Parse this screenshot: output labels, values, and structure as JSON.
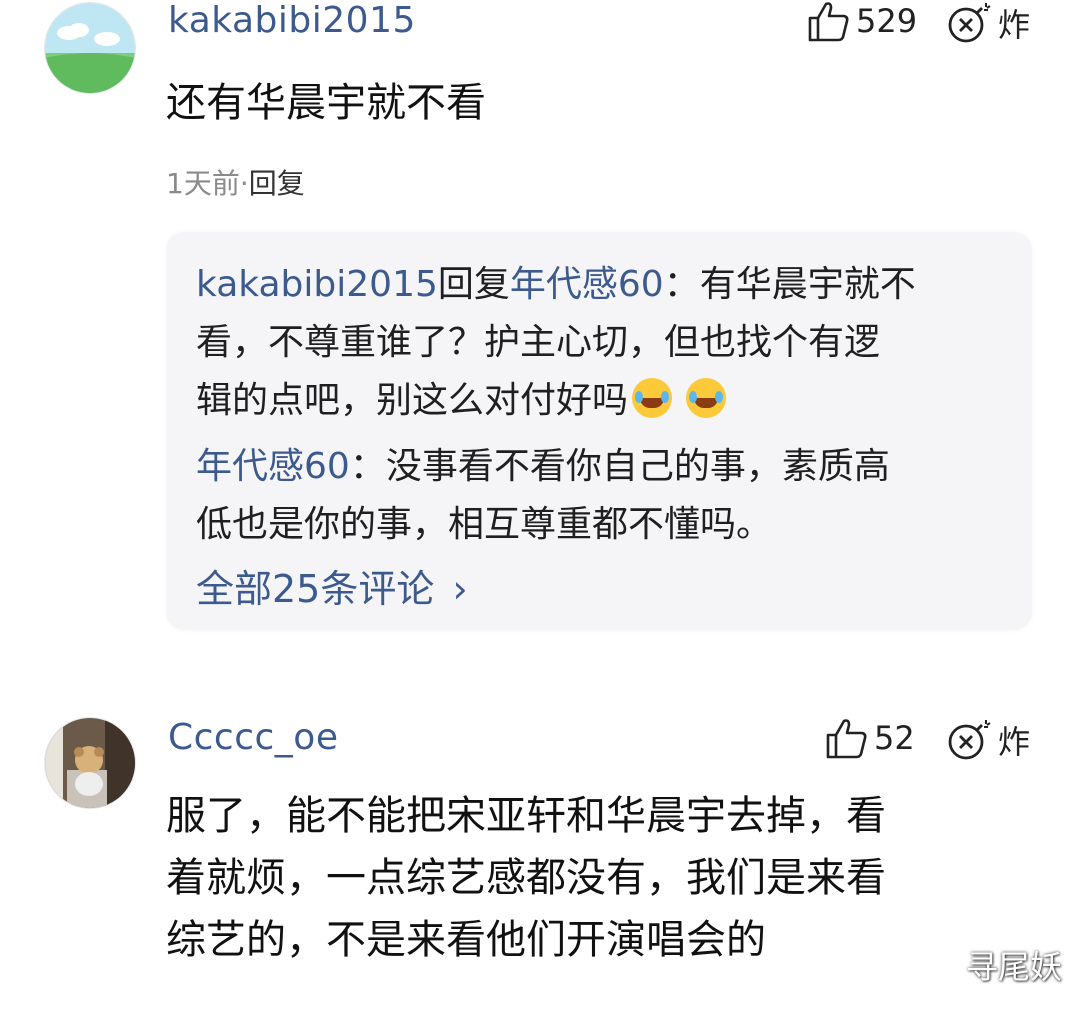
{
  "comments": [
    {
      "username": "kakabibi2015",
      "likes": "529",
      "bomb_label": "炸",
      "text": "还有华晨宇就不看",
      "time": "1天前",
      "separator": "·",
      "reply_label": "回复",
      "replies": [
        {
          "author": "kakabibi2015",
          "reply_word": "回复",
          "target": "年代感60",
          "colon": "：",
          "lines": [
            "有华晨宇就不",
            "看，不尊重谁了？护主心切，但也找个有逻",
            "辑的点吧，别这么对付好吗"
          ]
        },
        {
          "author": "年代感60",
          "colon": "：",
          "lines": [
            "没事看不看你自己的事，素质高",
            "低也是你的事，相互尊重都不懂吗。"
          ]
        }
      ],
      "all_comments": "全部25条评论",
      "all_comments_arrow": "›"
    },
    {
      "username": "Ccccc_oe",
      "likes": "52",
      "bomb_label": "炸",
      "lines": [
        "服了，能不能把宋亚轩和华晨宇去掉，看",
        "着就烦，一点综艺感都没有，我们是来看",
        "综艺的，不是来看他们开演唱会的"
      ]
    }
  ],
  "watermark": "寻尾妖",
  "colors": {
    "username": "#3d5a8f",
    "reply_box_bg": "#f5f5f7",
    "meta_gray": "#8a8a8a"
  },
  "icons": [
    "thumbs-up-icon",
    "bomb-icon",
    "laughing-crying-emoji",
    "chevron-right-icon"
  ]
}
